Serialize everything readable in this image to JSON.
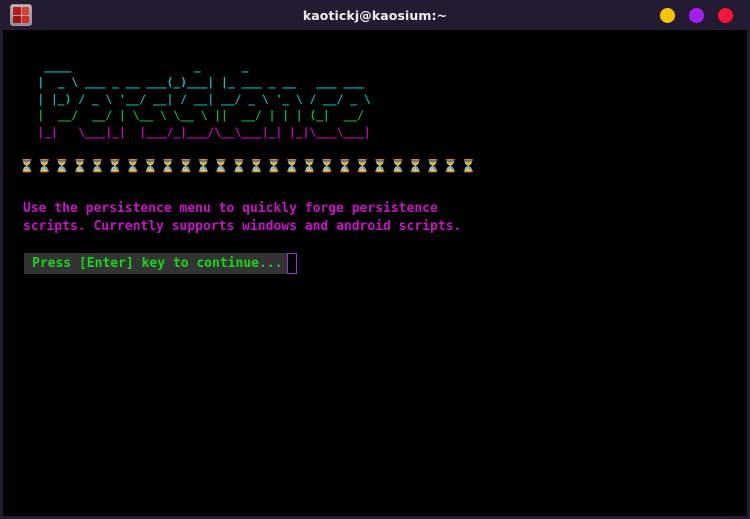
{
  "window": {
    "title": "kaotickj@kaosium:~",
    "icon_name": "terminal-app-icon",
    "controls": [
      {
        "name": "minimize",
        "label": "Minimize",
        "color": "#f5c400"
      },
      {
        "name": "maximize",
        "label": "Maximize",
        "color": "#a21ef5"
      },
      {
        "name": "close",
        "label": "Close",
        "color": "#fa123a"
      }
    ]
  },
  "terminal": {
    "background": "#000000",
    "banner": {
      "text": "Persistence",
      "colors": [
        "#00c8cd",
        "#00c8cd",
        "#00c2d2",
        "#07b8b3",
        "#00bb4a",
        "#d600c8"
      ],
      "lines": [
        "    ____                  _      _                      ",
        "   |  _ \\ ___ _ __ ___(_)___| |_ ___ _ __   ___ ___  ",
        "   | |_) / _ \\ '__/ __| / __| __/ _ \\ '_ \\ / __/ _ \\ ",
        "   |  __/  __/ | \\__ \\ \\__ \\ ||  __/ | | | (_|  __/ ",
        "   |_|   \\___|_|  |___/_|___/\\__\\___|_| |_|\\___\\___| "
      ],
      "separator_emoji": "⏳",
      "separator_count": 26
    },
    "message": "Use the persistence menu to quickly forge persistence\nscripts. Currently supports windows and android scripts.",
    "message_color": "#c813c8",
    "prompt": {
      "text": "Press [Enter] key to continue...",
      "text_color": "#19d519",
      "background": "#333333",
      "cursor_color": "#9b30d9"
    }
  }
}
